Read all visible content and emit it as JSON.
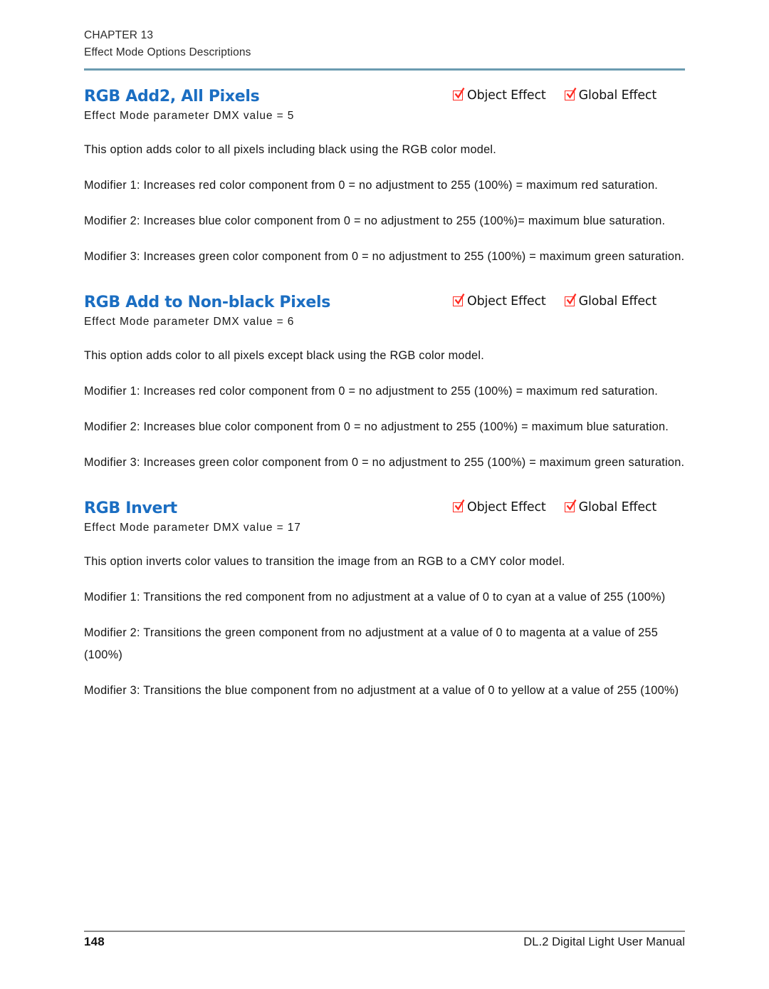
{
  "header": {
    "chapter": "CHAPTER 13",
    "subtitle": "Effect Mode Options Descriptions",
    "rule_color": "#6b9bb0"
  },
  "flags": {
    "object_effect_label": "Object Effect",
    "global_effect_label": "Global Effect",
    "checkbox_color": "#ff2a21",
    "checked": true
  },
  "theme": {
    "heading_color": "#1b6ec2",
    "body_color": "#151515"
  },
  "sections": [
    {
      "title": "RGB Add2, All Pixels",
      "dmx": "Effect Mode parameter DMX value =  5",
      "description": "This option adds color to all pixels including black using the RGB color model.",
      "modifiers": [
        "Modifier 1: Increases red color component from 0 =  no adjustment to 255 (100%) = maximum red saturation.",
        "Modifier 2: Increases blue color component from 0 =  no adjustment to 255 (100%)= maximum blue saturation.",
        "Modifier 3: Increases green color component from 0 =  no adjustment to 255 (100%) = maximum green saturation."
      ]
    },
    {
      "title": "RGB Add to Non-black Pixels",
      "dmx": "Effect Mode parameter DMX value =  6",
      "description": "This option adds color to all pixels except black using the RGB color model.",
      "modifiers": [
        "Modifier 1: Increases red color component from 0 =  no adjustment to 255 (100%) = maximum red saturation.",
        "Modifier 2: Increases blue color component from 0 =  no adjustment to 255 (100%) = maximum blue saturation.",
        "Modifier 3: Increases green color component from 0 =  no adjustment to 255 (100%) = maximum green saturation."
      ]
    },
    {
      "title": "RGB Invert",
      "dmx": "Effect Mode parameter DMX value =  17",
      "description": "This option inverts color values to transition the image from an RGB to a CMY color model.",
      "modifiers": [
        "Modifier 1: Transitions the red component from no adjustment at a value of 0 to cyan at a value of 255 (100%)",
        "Modifier 2: Transitions the green component from no adjustment at a value of 0 to magenta at a value of 255 (100%)",
        "Modifier 3: Transitions the blue component from no adjustment at a value of 0 to yellow at a value of 255 (100%)"
      ]
    }
  ],
  "footer": {
    "page_number": "148",
    "manual_title": "DL.2 Digital Light User Manual"
  }
}
